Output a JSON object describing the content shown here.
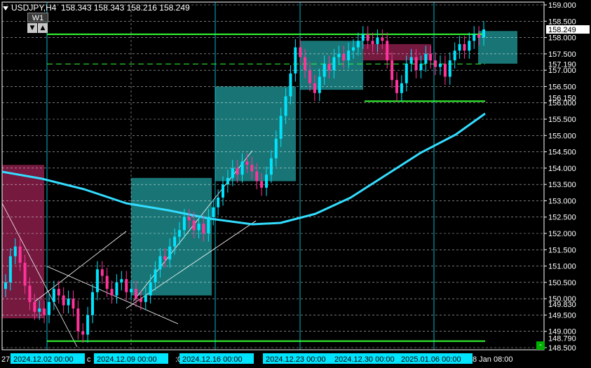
{
  "header": {
    "symbol": "USDJPY,H4",
    "quotes": "158.343 158.343 158.216 158.249"
  },
  "w1_label": "W1",
  "corner_label": "-",
  "colors": {
    "bg": "#000000",
    "grid": "#ffffff",
    "bull": "#00e5ff",
    "bear": "#ff3399",
    "ma": "#33ddff",
    "levels": "#33ff33",
    "box_teal": "#1d8a8a",
    "box_pink": "#8a1d4a",
    "tag_bg": "#00e5ff"
  },
  "chart_data": {
    "type": "candlestick",
    "symbol": "USDJPY",
    "timeframe": "H4",
    "ylim": [
      148.5,
      159.0
    ],
    "y_ticks": [
      148.5,
      149.0,
      149.5,
      150.0,
      150.5,
      151.0,
      151.5,
      152.0,
      152.5,
      153.0,
      153.5,
      154.0,
      154.5,
      155.0,
      155.5,
      156.0,
      156.5,
      157.0,
      157.5,
      158.0,
      158.5,
      159.0
    ],
    "price_labels": [
      {
        "value": 158.249,
        "text": "158.249",
        "highlight": true
      },
      {
        "value": 157.19,
        "text": "157.190"
      },
      {
        "value": 156.15,
        "text": "156.150"
      },
      {
        "value": 149.83,
        "text": "149.830"
      },
      {
        "value": 148.79,
        "text": "148.790"
      }
    ],
    "x_labels": [
      {
        "text": "27",
        "tag": false
      },
      {
        "text": "2024.12.02 00:00",
        "tag": true
      },
      {
        "text": "c",
        "tag": false
      },
      {
        "text": "2024.12.09 00:00",
        "tag": true
      },
      {
        "text": ":0",
        "tag": false
      },
      {
        "text": "2024.12.16 00:00",
        "tag": true
      },
      {
        "text": "2024.12.23 00:00",
        "tag": true
      },
      {
        "text": "2024.12.30 00:00",
        "tag": true
      },
      {
        "text": "2025.01.06 00:00",
        "tag": true
      },
      {
        "text": "8 Jan 08:00",
        "tag": false
      }
    ],
    "horizontal_levels": [
      {
        "value": 158.1,
        "style": "solid"
      },
      {
        "value": 157.19,
        "style": "dashed"
      },
      {
        "value": 156.05,
        "style": "solid",
        "short": true
      },
      {
        "value": 148.7,
        "style": "solid"
      }
    ],
    "closes": [
      150.5,
      151.3,
      151.6,
      151.1,
      150.4,
      149.9,
      149.6,
      149.7,
      149.5,
      149.9,
      150.3,
      150.1,
      149.8,
      150.0,
      149.7,
      149.0,
      148.9,
      149.5,
      150.2,
      150.9,
      150.7,
      150.3,
      150.1,
      150.5,
      150.6,
      150.2,
      150.3,
      150.0,
      149.9,
      150.1,
      150.5,
      150.9,
      151.3,
      151.2,
      151.6,
      151.9,
      152.1,
      152.5,
      152.4,
      152.1,
      152.3,
      152.0,
      152.5,
      152.8,
      153.1,
      153.5,
      153.7,
      154.0,
      153.8,
      154.2,
      154.1,
      153.9,
      153.6,
      153.4,
      153.8,
      154.3,
      154.9,
      155.6,
      156.2,
      156.9,
      157.7,
      157.4,
      157.0,
      156.6,
      156.3,
      156.8,
      157.2,
      157.0,
      157.4,
      157.5,
      157.3,
      157.6,
      157.7,
      157.9,
      158.1,
      157.9,
      157.8,
      158.0,
      157.9,
      157.3,
      156.7,
      156.3,
      156.6,
      157.2,
      157.4,
      157.0,
      157.2,
      157.5,
      157.3,
      157.1,
      157.2,
      156.8,
      157.3,
      157.6,
      157.8,
      157.6,
      157.9,
      158.1,
      158.0,
      158.249
    ]
  }
}
